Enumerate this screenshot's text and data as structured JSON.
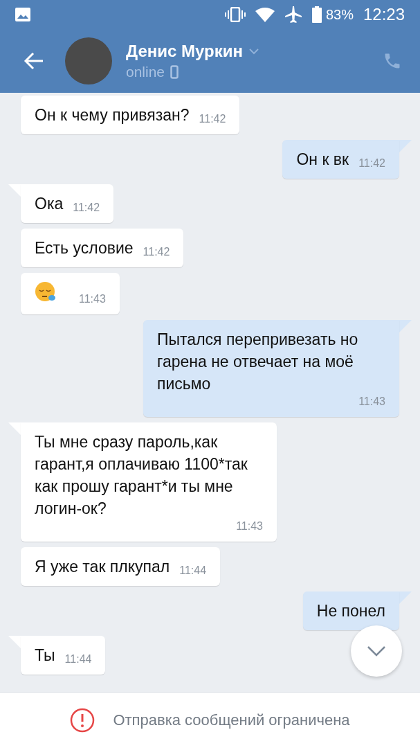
{
  "status_bar": {
    "battery": "83%",
    "time": "12:23"
  },
  "header": {
    "name": "Денис Муркин",
    "status": "online"
  },
  "messages": [
    {
      "kind": "text",
      "outgoing": false,
      "tail": false,
      "text": "Он к чему привязан?",
      "time": "11:42"
    },
    {
      "kind": "text",
      "outgoing": true,
      "tail": true,
      "text": "Он к вк",
      "time": "11:42"
    },
    {
      "kind": "text",
      "outgoing": false,
      "tail": true,
      "text": "Ока",
      "time": "11:42"
    },
    {
      "kind": "text",
      "outgoing": false,
      "tail": false,
      "text": "Есть условие",
      "time": "11:42"
    },
    {
      "kind": "emoji",
      "outgoing": false,
      "tail": false,
      "time": "11:43"
    },
    {
      "kind": "text",
      "outgoing": true,
      "tail": true,
      "text": "Пытался перепривезать но гарена не отвечает на моё письмо",
      "time": "11:43"
    },
    {
      "kind": "text",
      "outgoing": false,
      "tail": true,
      "text": "Ты мне сразу пароль,как гарант,я оплачиваю 1100*так как прошу гарант*и ты мне логин-ок?",
      "time": "11:43"
    },
    {
      "kind": "text",
      "outgoing": false,
      "tail": false,
      "text": "Я уже так плкупал",
      "time": "11:44"
    },
    {
      "kind": "text",
      "outgoing": true,
      "tail": true,
      "text": "Не понел"
    },
    {
      "kind": "text",
      "outgoing": false,
      "tail": true,
      "text": "Ты",
      "time": "11:44"
    }
  ],
  "notice": "Отправка сообщений ограничена"
}
